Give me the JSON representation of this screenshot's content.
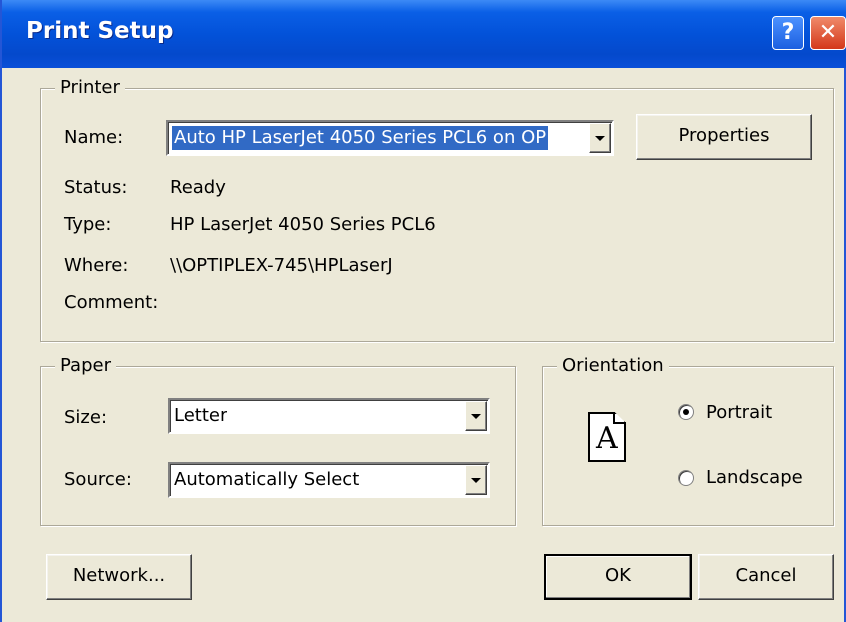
{
  "window": {
    "title": "Print Setup",
    "help_glyph": "?",
    "close_glyph": "✕"
  },
  "printer": {
    "group_label": "Printer",
    "name_label": "Name:",
    "name_value": "Auto HP LaserJet 4050 Series PCL6 on OP",
    "properties_label": "Properties",
    "status_label": "Status:",
    "status_value": "Ready",
    "type_label": "Type:",
    "type_value": "HP LaserJet 4050 Series PCL6",
    "where_label": "Where:",
    "where_value": "\\\\OPTIPLEX-745\\HPLaserJ",
    "comment_label": "Comment:",
    "comment_value": ""
  },
  "paper": {
    "group_label": "Paper",
    "size_label": "Size:",
    "size_value": "Letter",
    "source_label": "Source:",
    "source_value": "Automatically Select"
  },
  "orientation": {
    "group_label": "Orientation",
    "page_letter": "A",
    "portrait_label": "Portrait",
    "landscape_label": "Landscape",
    "selected": "portrait"
  },
  "buttons": {
    "network": "Network...",
    "ok": "OK",
    "cancel": "Cancel"
  },
  "colors": {
    "titlebar": "#0352d9",
    "dialog_bg": "#ece9d8",
    "selection": "#316ac5"
  }
}
